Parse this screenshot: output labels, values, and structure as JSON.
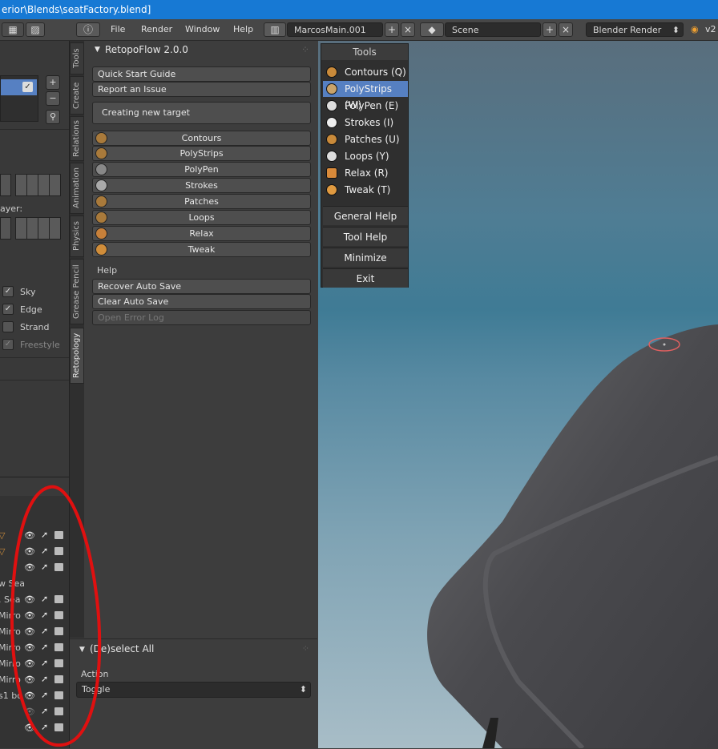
{
  "window": {
    "title": "erior\\Blends\\seatFactory.blend]"
  },
  "menu": {
    "file": "File",
    "render": "Render",
    "window": "Window",
    "help": "Help"
  },
  "screen_layout": {
    "value": "MarcosMain.001"
  },
  "scene": {
    "value": "Scene"
  },
  "render_engine": {
    "value": "Blender Render"
  },
  "version_label": "v2",
  "left_panel": {
    "layer_label": "ayer:",
    "checks": [
      {
        "label": "Sky",
        "checked": true
      },
      {
        "label": "Edge",
        "checked": true
      },
      {
        "label": "Strand",
        "checked": false
      },
      {
        "label": "Freestyle",
        "checked": true
      }
    ],
    "outliner_rows": [
      {
        "text": ""
      },
      {
        "text": ""
      },
      {
        "text": ""
      },
      {
        "text": "w Sea"
      },
      {
        "text": ". Sea"
      },
      {
        "text": "Mirro"
      },
      {
        "text": "Mirro"
      },
      {
        "text": "Mirro"
      },
      {
        "text": "Mirro"
      },
      {
        "text": "Mirro"
      },
      {
        "text": "s1 bo"
      },
      {
        "text": ""
      },
      {
        "text": ""
      }
    ]
  },
  "vertical_tabs": [
    "Tools",
    "Create",
    "Relations",
    "Animation",
    "Physics",
    "Grease Pencil",
    "Retopology"
  ],
  "retopoflow": {
    "title": "RetopoFlow 2.0.0",
    "quick_start": "Quick Start Guide",
    "report_issue": "Report an Issue",
    "target": "Creating new target",
    "tools": [
      "Contours",
      "PolyStrips",
      "PolyPen",
      "Strokes",
      "Patches",
      "Loops",
      "Relax",
      "Tweak"
    ],
    "help_label": "Help",
    "recover_auto_save": "Recover Auto Save",
    "clear_auto_save": "Clear Auto Save",
    "open_error_log": "Open Error Log"
  },
  "operator": {
    "title": "(De)select All",
    "action_label": "Action",
    "action_value": "Toggle"
  },
  "tools_menu": {
    "title": "Tools",
    "items": [
      {
        "label": "Contours (Q)",
        "selected": false
      },
      {
        "label": "PolyStrips (W)",
        "selected": true
      },
      {
        "label": "PolyPen (E)",
        "selected": false
      },
      {
        "label": "Strokes (I)",
        "selected": false
      },
      {
        "label": "Patches (U)",
        "selected": false
      },
      {
        "label": "Loops (Y)",
        "selected": false
      },
      {
        "label": "Relax (R)",
        "selected": false
      },
      {
        "label": "Tweak (T)",
        "selected": false
      }
    ],
    "general_help": "General Help",
    "tool_help": "Tool Help",
    "minimize": "Minimize",
    "exit": "Exit"
  },
  "colors": {
    "title_bar": "#1779d4",
    "selection": "#5680c2",
    "annotation": "#e01010"
  }
}
